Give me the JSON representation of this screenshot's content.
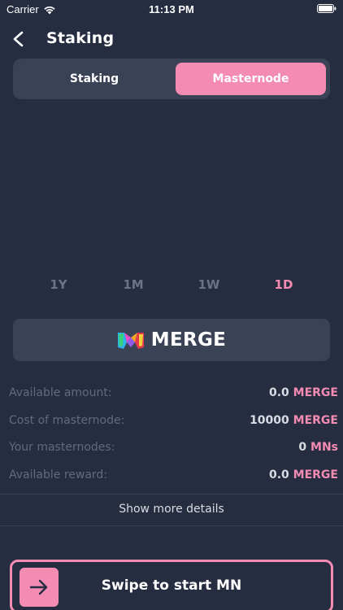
{
  "status_bar": {
    "carrier": "Carrier",
    "time": "11:13 PM"
  },
  "nav": {
    "title": "Staking",
    "back_icon": "chevron-left-icon"
  },
  "segments": {
    "left_label": "Staking",
    "right_label": "Masternode",
    "active": "Masternode"
  },
  "ranges": [
    {
      "label": "1Y",
      "active": false
    },
    {
      "label": "1M",
      "active": false
    },
    {
      "label": "1W",
      "active": false
    },
    {
      "label": "1D",
      "active": true
    }
  ],
  "token": {
    "name": "MERGE",
    "logo_icon": "merge-logo-icon"
  },
  "details": [
    {
      "label": "Available amount:",
      "amount": "0.0",
      "unit": "MERGE"
    },
    {
      "label": "Cost of masternode:",
      "amount": "10000",
      "unit": "MERGE"
    },
    {
      "label": "Your masternodes:",
      "amount": "0",
      "unit": "MNs"
    },
    {
      "label": "Available reward:",
      "amount": "0.0",
      "unit": "MERGE"
    }
  ],
  "show_more_label": "Show more details",
  "swipe": {
    "label": "Swipe to start MN",
    "handle_icon": "arrow-right-icon"
  },
  "colors": {
    "background": "#262d40",
    "card": "#3a4256",
    "accent": "#f48bb2",
    "muted": "#626a7d"
  }
}
